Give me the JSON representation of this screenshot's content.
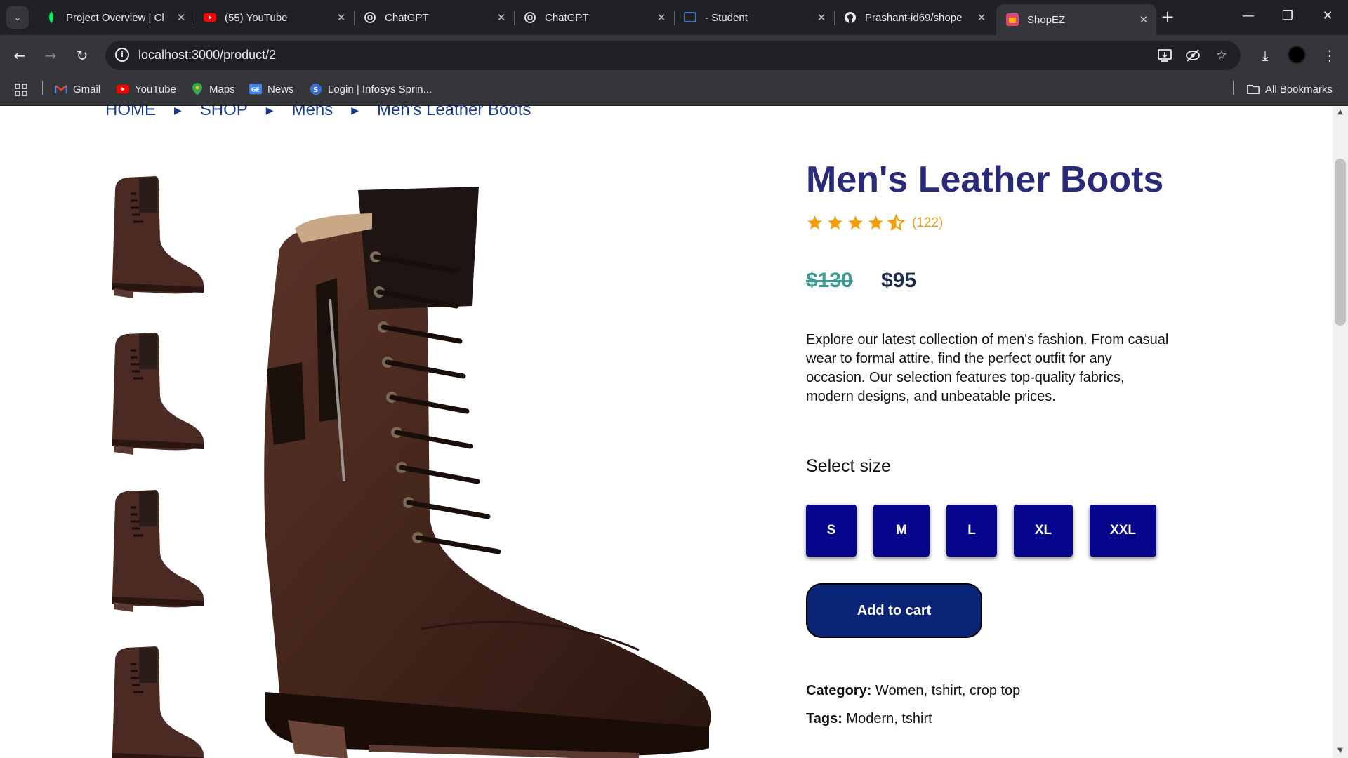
{
  "browser": {
    "tabs": [
      {
        "title": "Project Overview | Cl",
        "icon": "mongodb-leaf-icon"
      },
      {
        "title": "(55) YouTube",
        "icon": "youtube-icon"
      },
      {
        "title": "ChatGPT",
        "icon": "chatgpt-icon"
      },
      {
        "title": "ChatGPT",
        "icon": "chatgpt-icon"
      },
      {
        "title": "- Student",
        "icon": "student-portal-icon"
      },
      {
        "title": "Prashant-id69/shope",
        "icon": "github-icon"
      },
      {
        "title": "ShopEZ",
        "icon": "shopez-icon",
        "active": true
      }
    ],
    "url": "localhost:3000/product/2",
    "bookmarks": [
      {
        "label": "Gmail",
        "icon": "gmail-icon"
      },
      {
        "label": "YouTube",
        "icon": "youtube-icon"
      },
      {
        "label": "Maps",
        "icon": "maps-icon"
      },
      {
        "label": "News",
        "icon": "news-icon"
      },
      {
        "label": "Login | Infosys Sprin...",
        "icon": "infosys-icon"
      }
    ],
    "all_bookmarks": "All Bookmarks"
  },
  "breadcrumb": [
    "HOME",
    "SHOP",
    "Mens",
    "Men's Leather Boots"
  ],
  "product": {
    "title": "Men's Leather Boots",
    "rating": 4.5,
    "review_count": "(122)",
    "old_price": "$130",
    "price": "$95",
    "description": "Explore our latest collection of men's fashion. From casual wear to formal attire, find the perfect outfit for any occasion. Our selection features top-quality fabrics, modern designs, and unbeatable prices.",
    "size_label": "Select size",
    "sizes": [
      "S",
      "M",
      "L",
      "XL",
      "XXL"
    ],
    "add_to_cart": "Add to cart",
    "category_label": "Category:",
    "category_value": "Women, tshirt, crop top",
    "tags_label": "Tags:",
    "tags_value": "Modern, tshirt"
  },
  "colors": {
    "title": "#2a2a7a",
    "size_button": "#06068c",
    "cart_button": "#0a2478",
    "old_price": "#3c9990",
    "star": "#f59e0b",
    "breadcrumb": "#1a3a8f"
  }
}
